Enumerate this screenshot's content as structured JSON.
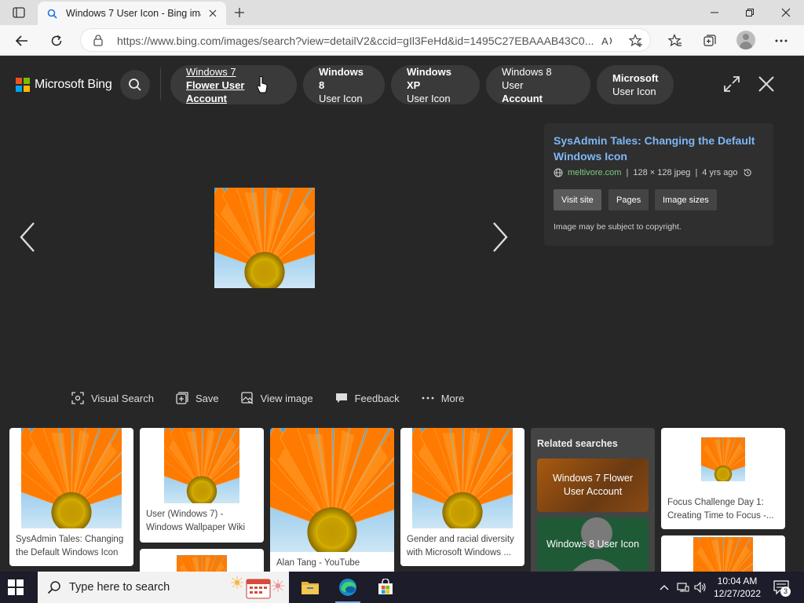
{
  "browser": {
    "tab_title": "Windows 7 User Icon - Bing images",
    "url": "https://www.bing.com/images/search?view=detailV2&ccid=gIl3FeHd&id=1495C27EBAAAB43C0..."
  },
  "bing": {
    "brand": "Microsoft Bing",
    "chips": [
      {
        "line1": "Windows 7",
        "line2": "Flower User Account"
      },
      {
        "line1": "Windows 8",
        "line2": "User Icon"
      },
      {
        "line1": "Windows XP",
        "line2": "User Icon"
      },
      {
        "line1": "Windows 8 User",
        "line2": "Account"
      },
      {
        "line1": "Microsoft",
        "line2": "User Icon"
      }
    ]
  },
  "detail": {
    "title": "SysAdmin Tales: Changing the Default Windows Icon",
    "site": "meltivore.com",
    "dimensions": "128 × 128 jpeg",
    "age": "4 yrs ago",
    "buttons": {
      "visit": "Visit site",
      "pages": "Pages",
      "sizes": "Image sizes"
    },
    "copyright": "Image may be subject to copyright."
  },
  "actions": {
    "visual_search": "Visual Search",
    "save": "Save",
    "view_image": "View image",
    "feedback": "Feedback",
    "more": "More"
  },
  "results": {
    "card1_caption": "SysAdmin Tales: Changing the Default Windows Icon",
    "card2_caption": "User (Windows 7) - Windows Wallpaper Wiki",
    "card3_caption": "Alan Tang - YouTube",
    "card4_caption": "Gender and racial diversity with Microsoft Windows ...",
    "card5_caption": "Focus Challenge Day 1: Creating Time to Focus -...",
    "related_heading": "Related searches",
    "related_items": [
      "Windows 7 Flower User Account",
      "Windows 8 User Icon"
    ]
  },
  "taskbar": {
    "search_placeholder": "Type here to search",
    "time": "10:04 AM",
    "date": "12/27/2022",
    "notification_count": "3"
  },
  "colors": {
    "accent_link": "#7fb7f5",
    "site_green": "#7ec97e",
    "petal_orange": "#ff7a00"
  }
}
